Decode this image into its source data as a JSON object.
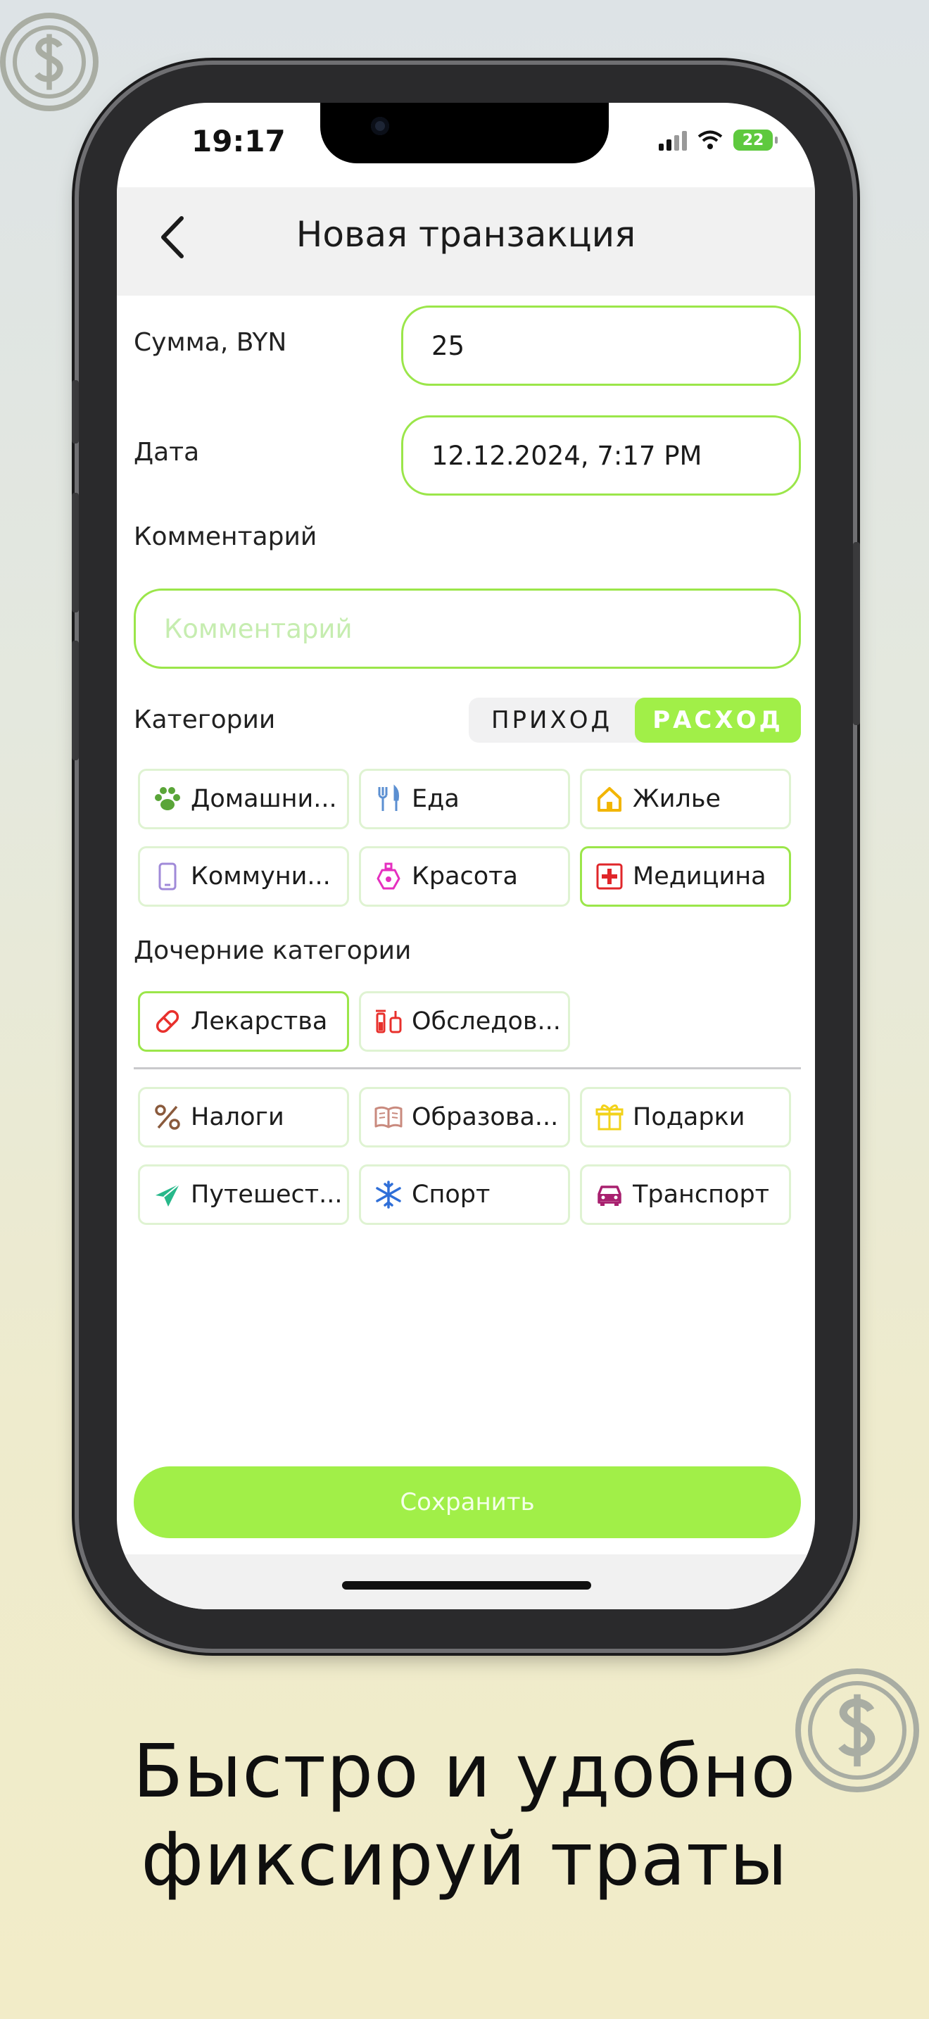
{
  "status_bar": {
    "time": "19:17",
    "battery": "22"
  },
  "header": {
    "title": "Новая транзакция",
    "back_icon": "chevron-left-icon"
  },
  "form": {
    "amount_label": "Сумма, BYN",
    "amount_value": "25",
    "date_label": "Дата",
    "date_value": "12.12.2024, 7:17 PM",
    "comment_label": "Комментарий",
    "comment_placeholder": "Комментарий"
  },
  "categories": {
    "label": "Категории",
    "segment": {
      "income": "ПРИХОД",
      "expense": "РАСХОД",
      "selected": "expense"
    },
    "items": [
      {
        "label": "Домашни...",
        "icon": "paw-icon",
        "color": "#5aa538",
        "selected": false
      },
      {
        "label": "Еда",
        "icon": "fork-knife-icon",
        "color": "#5b8fd1",
        "selected": false
      },
      {
        "label": "Жилье",
        "icon": "house-icon",
        "color": "#f2b500",
        "selected": false
      },
      {
        "label": "Коммуни...",
        "icon": "phone-icon",
        "color": "#a08ad8",
        "selected": false
      },
      {
        "label": "Красота",
        "icon": "perfume-icon",
        "color": "#e52fbf",
        "selected": false
      },
      {
        "label": "Медицина",
        "icon": "medical-cross-icon",
        "color": "#e0262a",
        "selected": true
      }
    ]
  },
  "subcategories": {
    "label": "Дочерние категории",
    "items": [
      {
        "label": "Лекарства",
        "icon": "pill-icon",
        "color": "#e8302c",
        "selected": true
      },
      {
        "label": "Обследов...",
        "icon": "lab-tests-icon",
        "color": "#e8302c",
        "selected": false
      }
    ]
  },
  "more_categories": [
    {
      "label": "Налоги",
      "icon": "percent-icon",
      "color": "#8a5a3c"
    },
    {
      "label": "Образова...",
      "icon": "book-icon",
      "color": "#c98a7e"
    },
    {
      "label": "Подарки",
      "icon": "gift-icon",
      "color": "#f2d21a"
    },
    {
      "label": "Путешест...",
      "icon": "airplane-icon",
      "color": "#27b88a"
    },
    {
      "label": "Спорт",
      "icon": "snowflake-icon",
      "color": "#2f6fd8"
    },
    {
      "label": "Транспорт",
      "icon": "car-icon",
      "color": "#a8206f"
    }
  ],
  "save_button": "Сохранить",
  "tagline": {
    "line1": "Быстро и удобно",
    "line2": "фиксируй траты"
  },
  "colors": {
    "accent": "#a1ef48",
    "field_border": "#9be64a",
    "coin": "#a9ada3"
  }
}
